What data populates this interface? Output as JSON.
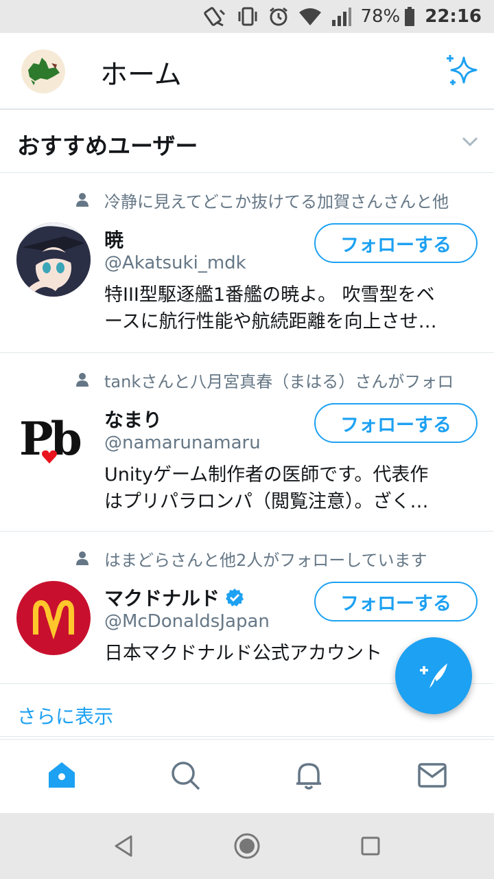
{
  "status_bar": {
    "battery_percent": "78%",
    "time": "22:16",
    "icons": [
      "vibrate-off-icon",
      "vibrate-icon",
      "alarm-icon",
      "wifi-icon",
      "signal-icon",
      "battery-icon"
    ]
  },
  "header": {
    "title": "ホーム",
    "profile_icon": "profile-avatar",
    "top_tweets_icon": "sparkle-icon"
  },
  "section": {
    "title": "おすすめユーザー",
    "toggle_icon": "chevron-down-icon"
  },
  "users": [
    {
      "context": "冷静に見えてどこか抜けてる加賀さんさんと他",
      "name": "暁",
      "handle": "@Akatsuki_mdk",
      "bio_line1": "特III型駆逐艦1番艦の暁よ。 吹雪型をベ",
      "bio_line2": "ースに航行性能や航続距離を向上させ…",
      "follow_label": "フォローする"
    },
    {
      "context": "tankさんと八月宮真春（まはる）さんがフォロ",
      "name": "なまり",
      "handle": "@namarunamaru",
      "bio_line1": "Unityゲーム制作者の医師です。代表作",
      "bio_line2": "はプリパラロンパ（閲覧注意）。ざく…",
      "follow_label": "フォローする",
      "avatar_text": "Pb"
    },
    {
      "context": "はまどらさんと他2人がフォローしています",
      "name": "マクドナルド",
      "handle": "@McDonaldsJapan",
      "bio_line1": "日本マクドナルド公式アカウント",
      "follow_label": "フォローする",
      "verified": true
    }
  ],
  "show_more": "さらに表示",
  "tabs": [
    "home-icon",
    "search-icon",
    "notifications-icon",
    "messages-icon"
  ],
  "colors": {
    "accent": "#1da1f2",
    "text": "#14171a",
    "muted": "#657786",
    "mcdonalds_red": "#c8102e",
    "mcdonalds_gold": "#ffc72c"
  }
}
